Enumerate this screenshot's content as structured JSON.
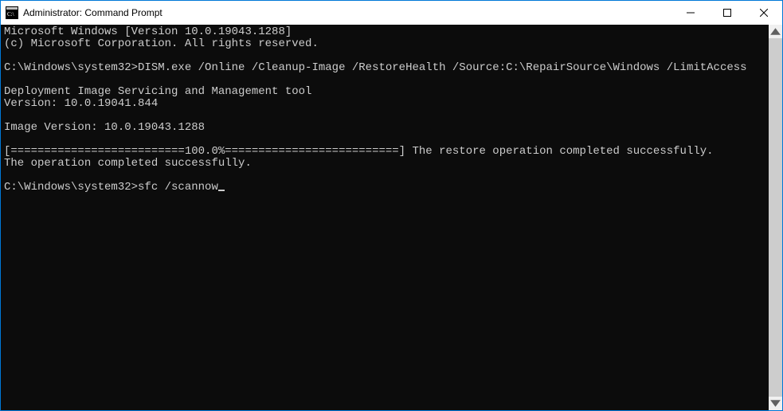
{
  "window": {
    "title": "Administrator: Command Prompt"
  },
  "terminal": {
    "lines": [
      "Microsoft Windows [Version 10.0.19043.1288]",
      "(c) Microsoft Corporation. All rights reserved.",
      "",
      "C:\\Windows\\system32>DISM.exe /Online /Cleanup-Image /RestoreHealth /Source:C:\\RepairSource\\Windows /LimitAccess",
      "",
      "Deployment Image Servicing and Management tool",
      "Version: 10.0.19041.844",
      "",
      "Image Version: 10.0.19043.1288",
      "",
      "[==========================100.0%==========================] The restore operation completed successfully.",
      "The operation completed successfully.",
      ""
    ],
    "prompt": "C:\\Windows\\system32>",
    "current_input": "sfc /scannow"
  }
}
